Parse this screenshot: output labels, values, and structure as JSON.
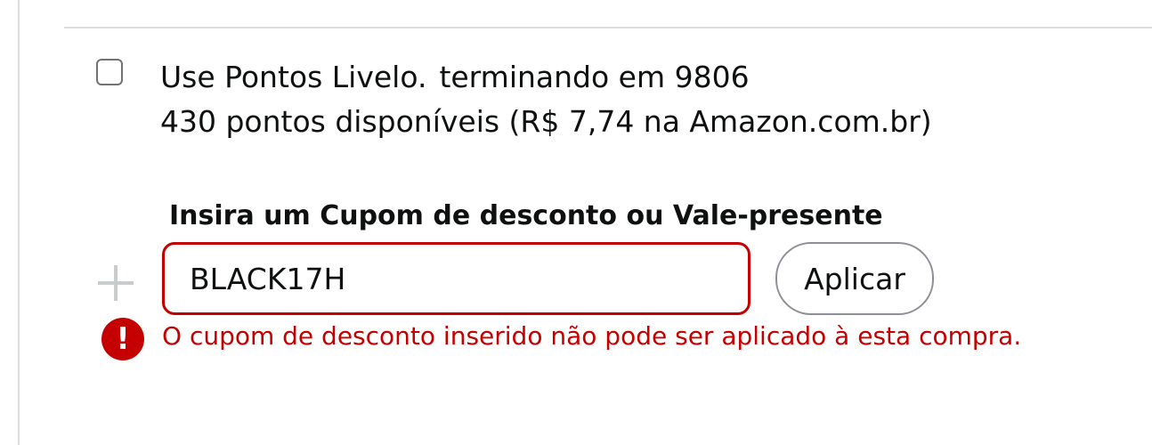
{
  "points": {
    "line1_part1": "Use Pontos Livelo.",
    "line1_part2": "terminando em 9806",
    "line2": "430 pontos disponíveis (R$ 7,74 na Amazon.com.br)",
    "checked": false
  },
  "coupon": {
    "label": "Insira um Cupom de desconto ou Vale-presente",
    "value": "BLACK17H",
    "apply_label": "Aplicar",
    "error_message": "O cupom de desconto inserido não pode ser aplicado à esta compra.",
    "error_icon_glyph": "!"
  },
  "colors": {
    "error": "#c40000",
    "divider": "#dddddd",
    "text": "#0f1111"
  },
  "icons": {
    "plus": "plus-icon",
    "error": "exclamation-circle-icon",
    "checkbox": "checkbox-icon"
  }
}
